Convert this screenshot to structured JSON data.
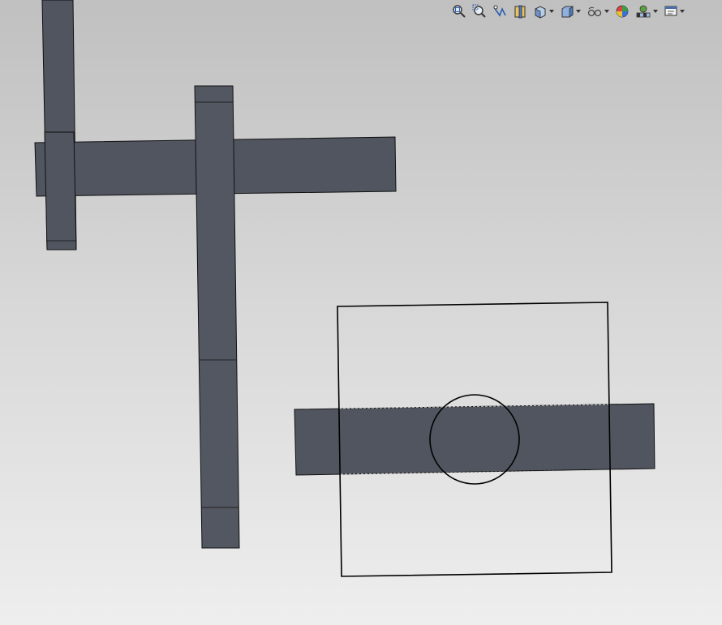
{
  "toolbar": {
    "items": [
      {
        "name": "zoom-to-fit",
        "icon": "zoom-to-fit-icon",
        "dropdown": false
      },
      {
        "name": "zoom-to-area",
        "icon": "zoom-to-area-icon",
        "dropdown": false
      },
      {
        "name": "previous-view",
        "icon": "previous-view-icon",
        "dropdown": false
      },
      {
        "name": "section-view",
        "icon": "section-view-icon",
        "dropdown": false
      },
      {
        "name": "view-orientation",
        "icon": "view-orientation-icon",
        "dropdown": true
      },
      {
        "name": "display-style",
        "icon": "display-style-icon",
        "dropdown": true
      },
      {
        "name": "hide-show-items",
        "icon": "hide-show-items-icon",
        "dropdown": true
      },
      {
        "name": "edit-appearance",
        "icon": "edit-appearance-icon",
        "dropdown": false
      },
      {
        "name": "apply-scene",
        "icon": "apply-scene-icon",
        "dropdown": true
      },
      {
        "name": "view-settings",
        "icon": "view-settings-icon",
        "dropdown": true
      }
    ]
  },
  "colors": {
    "part_fill": "#51555f",
    "part_face_light": "#585c66",
    "edge": "#101010",
    "sketch_line": "#000000",
    "background_top": "#c0c0c0",
    "background_bottom": "#eeeeee"
  }
}
